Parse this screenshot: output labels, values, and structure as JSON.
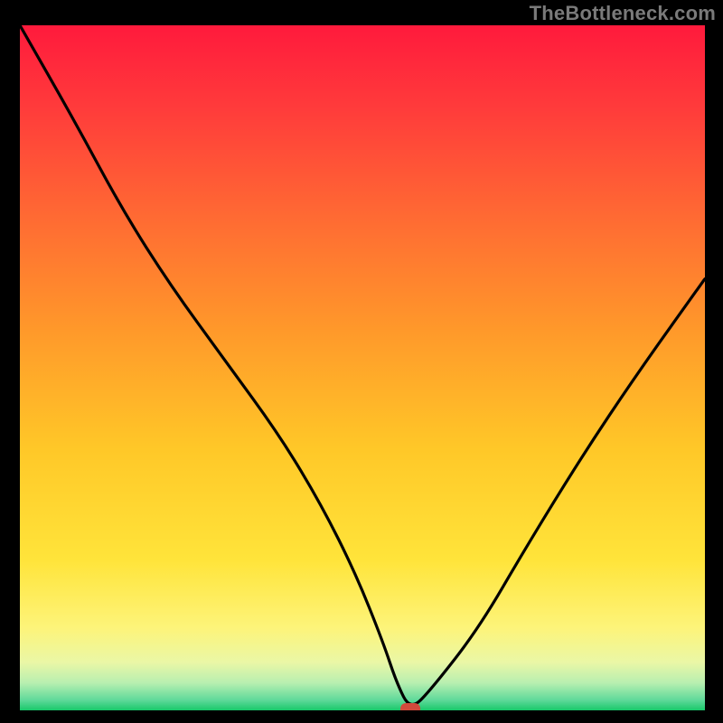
{
  "attribution": "TheBottleneck.com",
  "chart_data": {
    "type": "line",
    "title": "",
    "xlabel": "",
    "ylabel": "",
    "xlim": [
      0,
      100
    ],
    "ylim": [
      0,
      100
    ],
    "series": [
      {
        "name": "bottleneck-curve",
        "x": [
          0,
          8,
          15,
          22,
          30,
          38,
          44,
          49,
          53,
          55,
          57,
          60,
          67,
          74,
          82,
          90,
          100
        ],
        "values": [
          100,
          86,
          73,
          62,
          51,
          40,
          30,
          20,
          10,
          4,
          0,
          3,
          12,
          24,
          37,
          49,
          63
        ]
      }
    ],
    "marker": {
      "x": 57,
      "y": 0
    },
    "gradient_stops": [
      {
        "offset": 0.0,
        "color": "#ff1a3c"
      },
      {
        "offset": 0.12,
        "color": "#ff3b3b"
      },
      {
        "offset": 0.28,
        "color": "#ff6a33"
      },
      {
        "offset": 0.45,
        "color": "#ff9a2a"
      },
      {
        "offset": 0.62,
        "color": "#ffc828"
      },
      {
        "offset": 0.78,
        "color": "#ffe43a"
      },
      {
        "offset": 0.88,
        "color": "#fdf47a"
      },
      {
        "offset": 0.93,
        "color": "#eaf7a6"
      },
      {
        "offset": 0.96,
        "color": "#b8efb0"
      },
      {
        "offset": 0.985,
        "color": "#5fd99a"
      },
      {
        "offset": 1.0,
        "color": "#18c86a"
      }
    ]
  }
}
